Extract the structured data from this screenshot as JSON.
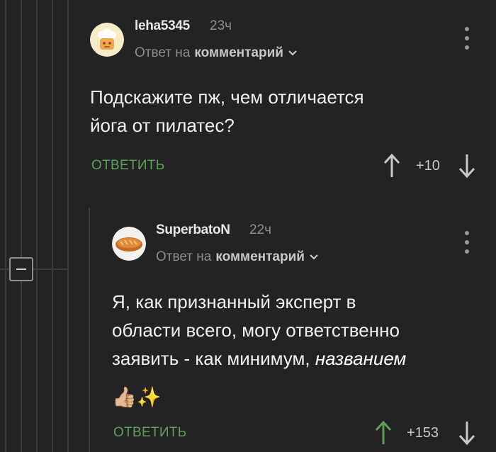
{
  "comments": [
    {
      "username": "leha5345",
      "time": "23ч",
      "reply_prefix": "Ответ на",
      "reply_target": "комментарий",
      "text_line1": "Подскажите пж, чем отличается",
      "text_line2": "йога от пилатес?",
      "reply_label": "ОТВЕТИТЬ",
      "rating": "+10",
      "icons": {
        "avatar": "chef-hat-avatar",
        "menu": "more-vertical-icon",
        "upvote": "arrow-up-icon",
        "downvote": "arrow-down-icon"
      }
    },
    {
      "username": "SuperbatoN",
      "time": "22ч",
      "reply_prefix": "Ответ на",
      "reply_target": "комментарий",
      "text_line1": "Я, как признанный эксперт в",
      "text_line2": "области всего, могу ответственно",
      "text_line3_plain": "заявить - как минимум, ",
      "text_line3_italic": "названием",
      "emoji_text": "👍🏼✨",
      "reply_label": "ОТВЕТИТЬ",
      "rating": "+153",
      "upvoted": true,
      "icons": {
        "avatar": "bread-loaf-avatar",
        "menu": "more-vertical-icon",
        "upvote": "arrow-up-icon",
        "downvote": "arrow-down-icon"
      }
    }
  ],
  "colors": {
    "background": "#232325",
    "accent_green": "#5aa155",
    "muted": "#8c8c8e"
  }
}
